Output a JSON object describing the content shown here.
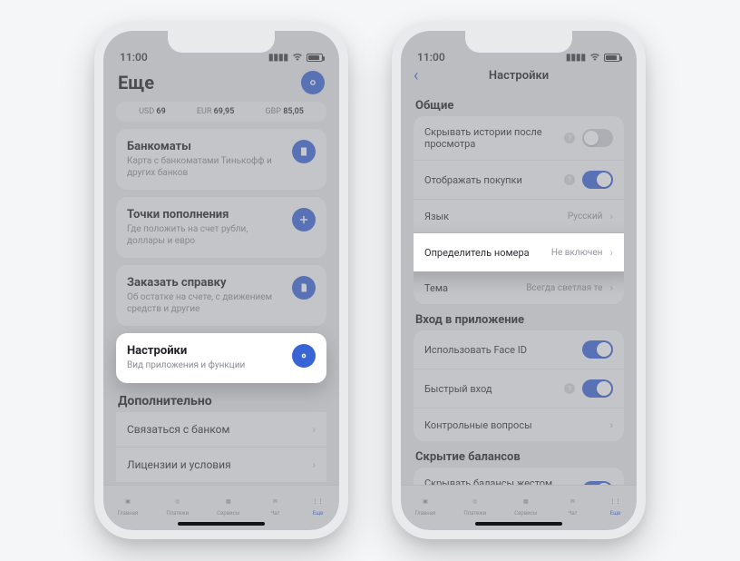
{
  "status": {
    "time": "11:00"
  },
  "left": {
    "title": "Еще",
    "rates": {
      "usd_label": "USD",
      "usd_val": "69",
      "eur_label": "EUR",
      "eur_val": "69,95",
      "gbp_label": "GBP",
      "gbp_val": "85,05"
    },
    "cards": {
      "atms": {
        "title": "Банкоматы",
        "sub": "Карта с банкоматами Тинькофф и других банков"
      },
      "topup": {
        "title": "Точки пополнения",
        "sub": "Где положить на счет рубли, доллары и евро"
      },
      "statement": {
        "title": "Заказать справку",
        "sub": "Об остатке на счете, с движением средств и другие"
      },
      "settings": {
        "title": "Настройки",
        "sub": "Вид приложения и функции"
      }
    },
    "extra_title": "Дополнительно",
    "extra": {
      "contact": "Связаться с банком",
      "licenses": "Лицензии и условия"
    },
    "tabs": {
      "main": "Главная",
      "payments": "Платежи",
      "services": "Сервисы",
      "chat": "Чат",
      "more": "Еще"
    }
  },
  "right": {
    "nav_title": "Настройки",
    "general_title": "Общие",
    "general": {
      "hide_history": "Скрывать истории после просмотра",
      "show_purchases": "Отображать покупки",
      "language_label": "Язык",
      "language_value": "Русский",
      "callerid_label": "Определитель номера",
      "callerid_value": "Не включен",
      "theme_label": "Тема",
      "theme_value": "Всегда светлая те"
    },
    "login_title": "Вход в приложение",
    "login": {
      "faceid": "Использовать Face ID",
      "quick": "Быстрый вход",
      "questions": "Контрольные вопросы"
    },
    "balances_title": "Скрытие балансов",
    "balances": {
      "hide_gesture": "Скрывать балансы жестом переворота"
    }
  }
}
